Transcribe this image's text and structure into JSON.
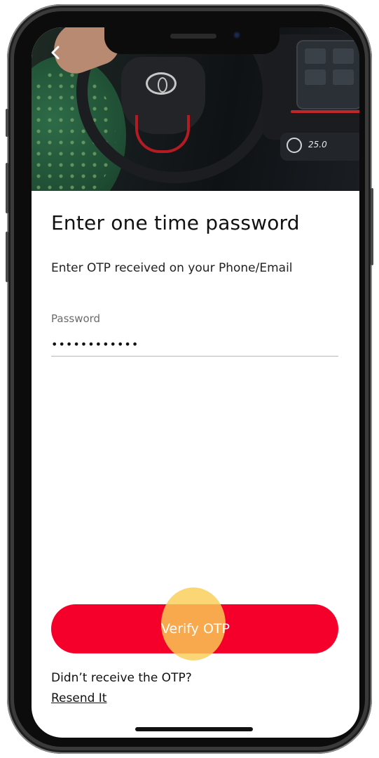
{
  "header": {
    "back_icon": "chevron-left-icon",
    "hero_temperature": "25.0"
  },
  "main": {
    "title": "Enter one time password",
    "subtitle": "Enter OTP received on your Phone/Email",
    "password_label": "Password",
    "password_value": "123456789012"
  },
  "actions": {
    "verify_label": "Verify OTP",
    "verify_color": "#f5002a",
    "touch_indicator_color": "#f9cd56"
  },
  "footer": {
    "prompt": "Didn’t receive the OTP?",
    "resend_label": "Resend It"
  }
}
